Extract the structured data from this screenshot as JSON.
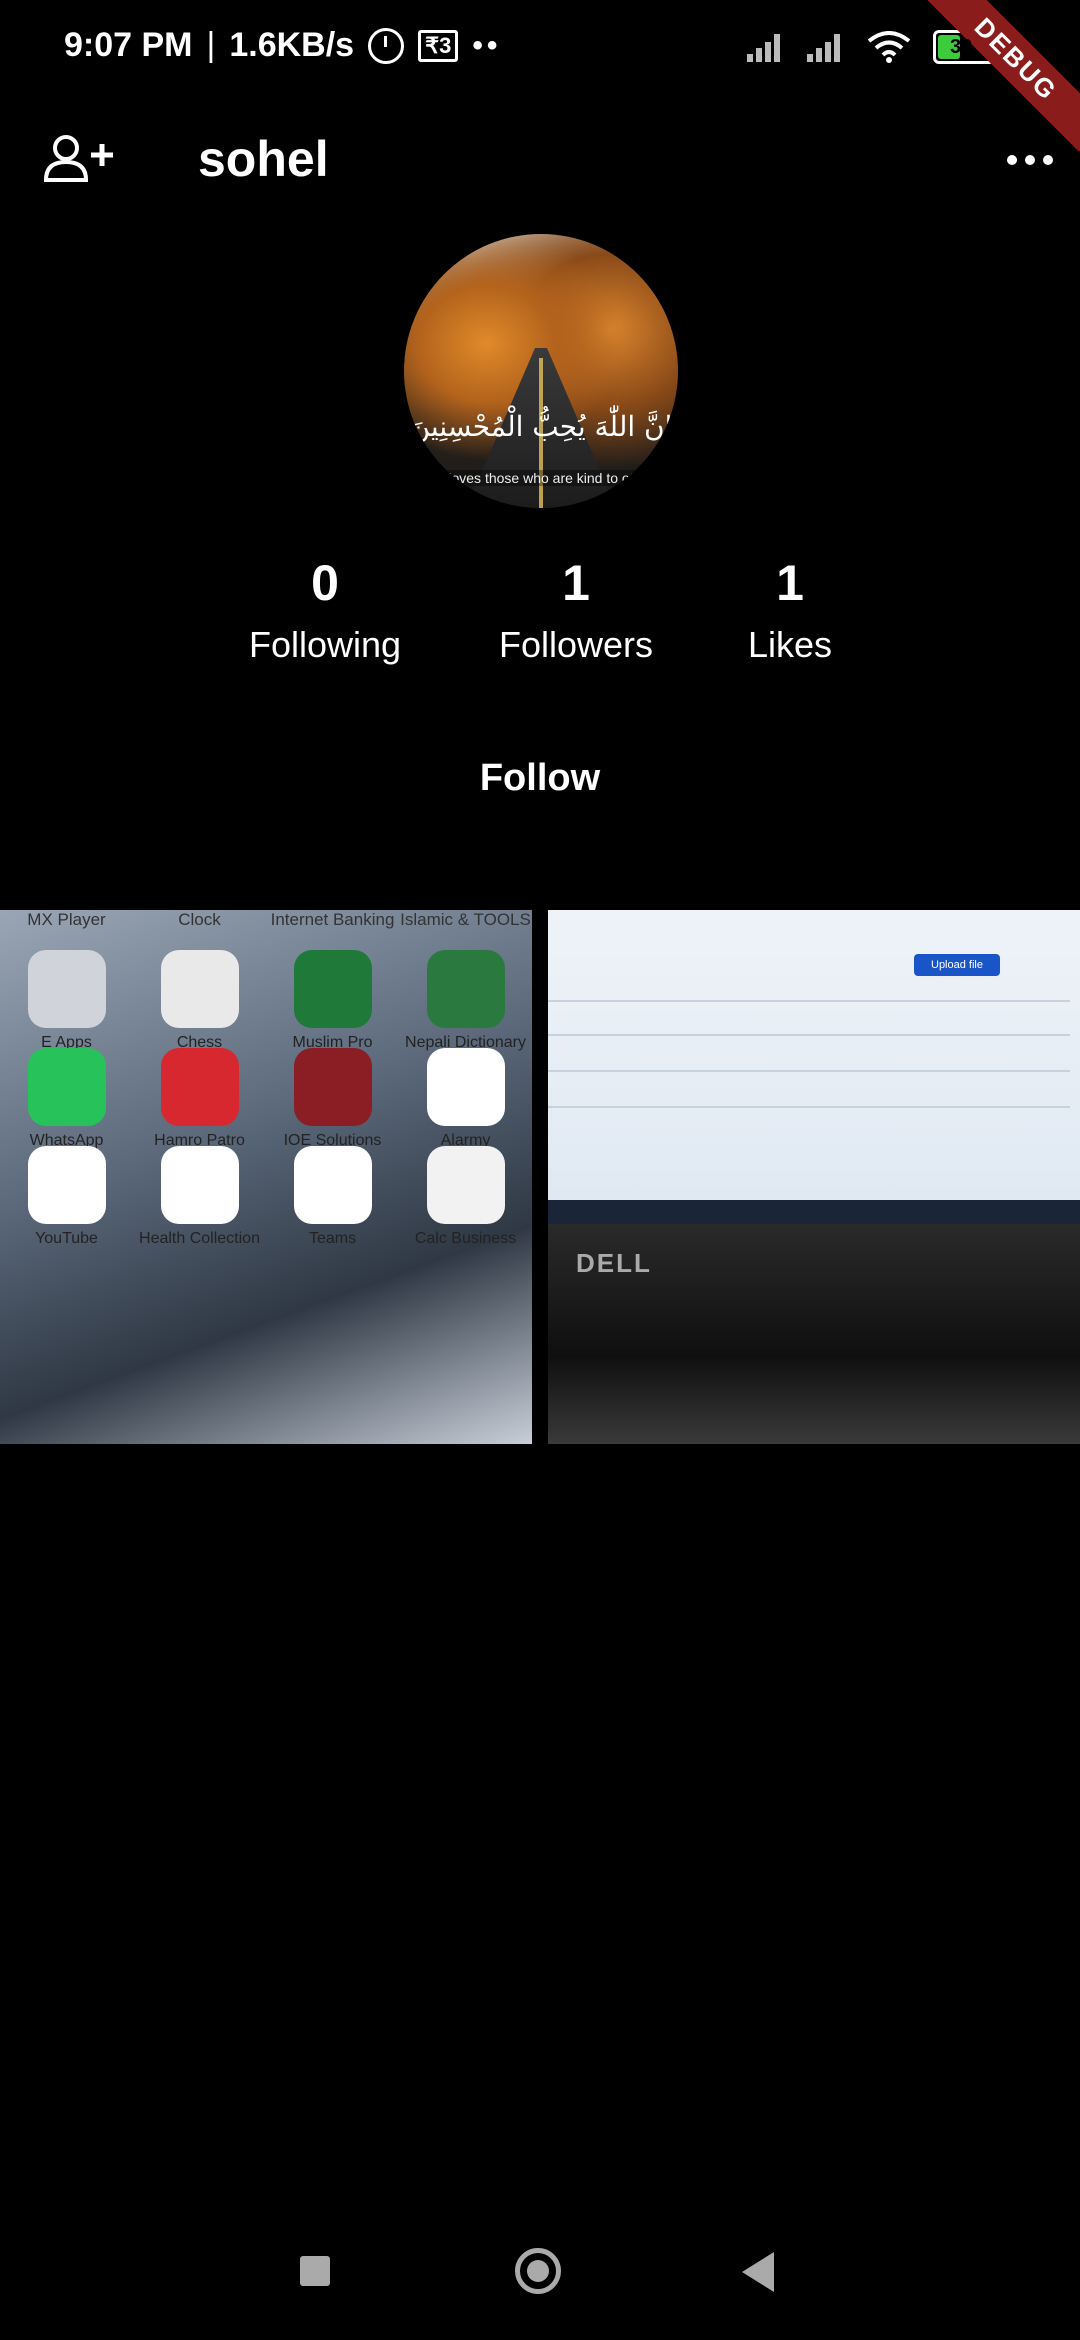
{
  "status_bar": {
    "time": "9:07 PM",
    "separator": "|",
    "speed": "1.6KB/s",
    "currency_badge": "₹3",
    "dots": "••",
    "battery_level": "39",
    "debug_label": "DEBUG"
  },
  "app_bar": {
    "username": "sohel",
    "add_person_icon": "person-add-icon",
    "more_icon": "more-horizontal-icon"
  },
  "avatar": {
    "arabic_text": "إِنَّ اللّٰهَ يُحِبُّ الْمُحْسِنِينَ",
    "caption": "loves those who are kind to ot"
  },
  "stats": {
    "following": {
      "count": "0",
      "label": "Following"
    },
    "followers": {
      "count": "1",
      "label": "Followers"
    },
    "likes": {
      "count": "1",
      "label": "Likes"
    }
  },
  "follow_button": "Follow",
  "posts": {
    "post1": {
      "top_labels": [
        "MX Player",
        "Clock",
        "Internet Banking",
        "Islamic & TOOLS"
      ],
      "apps": [
        {
          "label": "E Apps",
          "color": "#d0d4da"
        },
        {
          "label": "Chess",
          "color": "#e9e9e9"
        },
        {
          "label": "Muslim Pro",
          "color": "#1f7a3a"
        },
        {
          "label": "Nepali Dictionary",
          "color": "#2a7a3f"
        },
        {
          "label": "WhatsApp",
          "color": "#28c25a"
        },
        {
          "label": "Hamro Patro",
          "color": "#d7282f"
        },
        {
          "label": "IOE Solutions",
          "color": "#8a1e24"
        },
        {
          "label": "Alarmy",
          "color": "#ffffff"
        },
        {
          "label": "YouTube",
          "color": "#ffffff"
        },
        {
          "label": "Health Collection",
          "color": "#ffffff"
        },
        {
          "label": "Teams",
          "color": "#ffffff"
        },
        {
          "label": "Calc Business",
          "color": "#f2f2f2"
        }
      ]
    },
    "post2": {
      "upload_label": "Upload file",
      "brand": "DELL"
    }
  },
  "nav_bar": {
    "recents_icon": "square-icon",
    "home_icon": "circle-home-icon",
    "back_icon": "triangle-back-icon"
  }
}
